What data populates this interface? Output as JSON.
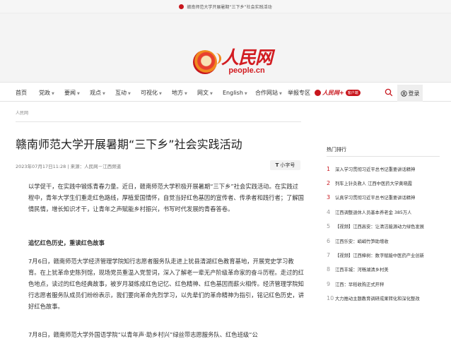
{
  "topbar": {
    "text": "赣南师范大学开展暑期“三下乡”社会实践活动"
  },
  "logo": {
    "cn": "人民网",
    "en": "people.cn"
  },
  "nav": {
    "items": [
      {
        "label": "首页",
        "caret": false
      },
      {
        "label": "党政",
        "caret": true
      },
      {
        "label": "要闻",
        "caret": true
      },
      {
        "label": "观点",
        "caret": true
      },
      {
        "label": "互动",
        "caret": true
      },
      {
        "label": "可视化",
        "caret": true
      },
      {
        "label": "地方",
        "caret": true
      },
      {
        "label": "网文",
        "caret": true
      },
      {
        "label": "English",
        "caret": true
      },
      {
        "label": "合作网站",
        "caret": true
      },
      {
        "label": "举报专区",
        "caret": false
      }
    ],
    "app_logo": "人民网+",
    "app_badge": "客户端",
    "login": "登录"
  },
  "breadcrumb": "人民网",
  "article": {
    "title": "赣南师范大学开展暑期“三下乡”社会实践活动",
    "meta": "2023年07月17日11:28 | 来源：人民网－江西频道",
    "font_btn": "小字号",
    "p1": "以学促干，在实践中锻炼青春力量。近日，赣南师范大学积极开展暑期“三下乡”社会实践活动。在实践过程中，青年大学生们重走红色路线，厚植爱国情怀，自觉当好红色基因的宣传者、传承者和践行者；了解国情民情，增长知识才干，让青年之声赋能乡村振兴，书写时代发展的青春答卷。",
    "p2": "追忆红色历史，重读红色故事",
    "p3": "7月6日，赣南师范大学经济管理学院知行志愿者服务队走进上犹县清湖红色教育基地，开展党史学习教育。在上犹革命史陈列馆，现场党员重温入党誓词，深入了解老一辈无产阶级革命家的奋斗历程。走过的红色地点，读过的红色经典故事，被岁月凝练成红色记忆、红色精神、红色基因而薪火相传。经济管理学院知行志愿者服务队成员们纷纷表示，我们要向革命先烈学习，以先辈们的革命精神为指引，铭记红色历史，讲好红色故事。",
    "p4": "7月8日，赣南师范大学外国语学院“以青年声·助乡村兴”绿丝带志愿服务队、红色班级“公"
  },
  "sidebar": {
    "title": "热门排行",
    "items": [
      {
        "num": "1",
        "text": "深入学习贯彻习近平总书记重要讲话精神"
      },
      {
        "num": "2",
        "text": "列车上针灸救人 江西中医药大学黄晓霞"
      },
      {
        "num": "3",
        "text": "认真学习贯彻习近平总书记重要讲话精神"
      },
      {
        "num": "4",
        "text": "江西调整退休人员基本养老金 385万人"
      },
      {
        "num": "5",
        "text": "【视频】江西高安：让清洁能源动力绿色发展"
      },
      {
        "num": "6",
        "text": "江西乐安：峭峭竹笋助增收"
      },
      {
        "num": "7",
        "text": "【视频】江西樟树：数字赋能中医药产业创新"
      },
      {
        "num": "8",
        "text": "江西丰城：河畅湖清乡村美"
      },
      {
        "num": "9",
        "text": "江西：早稻收购正式开秤"
      },
      {
        "num": "10",
        "text": "大力推动主题教育调研成果转化和深化整改"
      }
    ]
  }
}
